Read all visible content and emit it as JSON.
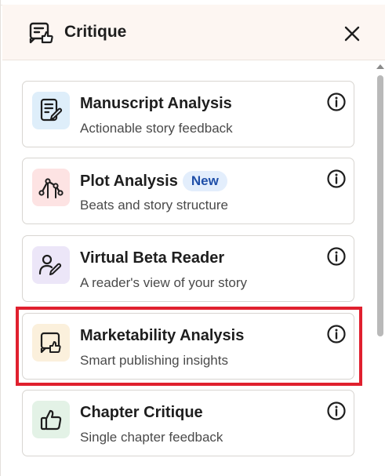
{
  "header": {
    "title": "Critique",
    "icon": "critique-icon",
    "close_icon": "close-icon"
  },
  "cards": [
    {
      "title": "Manuscript Analysis",
      "subtitle": "Actionable story feedback",
      "icon": "manuscript-icon",
      "icon_bg": "#deeefa",
      "badge": ""
    },
    {
      "title": "Plot Analysis",
      "subtitle": "Beats and story structure",
      "icon": "plot-graph-icon",
      "icon_bg": "#fde3e3",
      "badge": "New"
    },
    {
      "title": "Virtual Beta Reader",
      "subtitle": "A reader's view of your story",
      "icon": "beta-reader-icon",
      "icon_bg": "#ece6f8",
      "badge": ""
    },
    {
      "title": "Marketability Analysis",
      "subtitle": "Smart publishing insights",
      "icon": "marketability-icon",
      "icon_bg": "#fbf0dc",
      "badge": ""
    },
    {
      "title": "Chapter Critique",
      "subtitle": "Single chapter feedback",
      "icon": "thumbs-up-icon",
      "icon_bg": "#e3f2e6",
      "badge": ""
    }
  ],
  "colors": {
    "highlight": "#e0202e",
    "badge_bg": "#e3eefc",
    "badge_text": "#1f4fa8",
    "header_bg": "#fdf6f2"
  }
}
